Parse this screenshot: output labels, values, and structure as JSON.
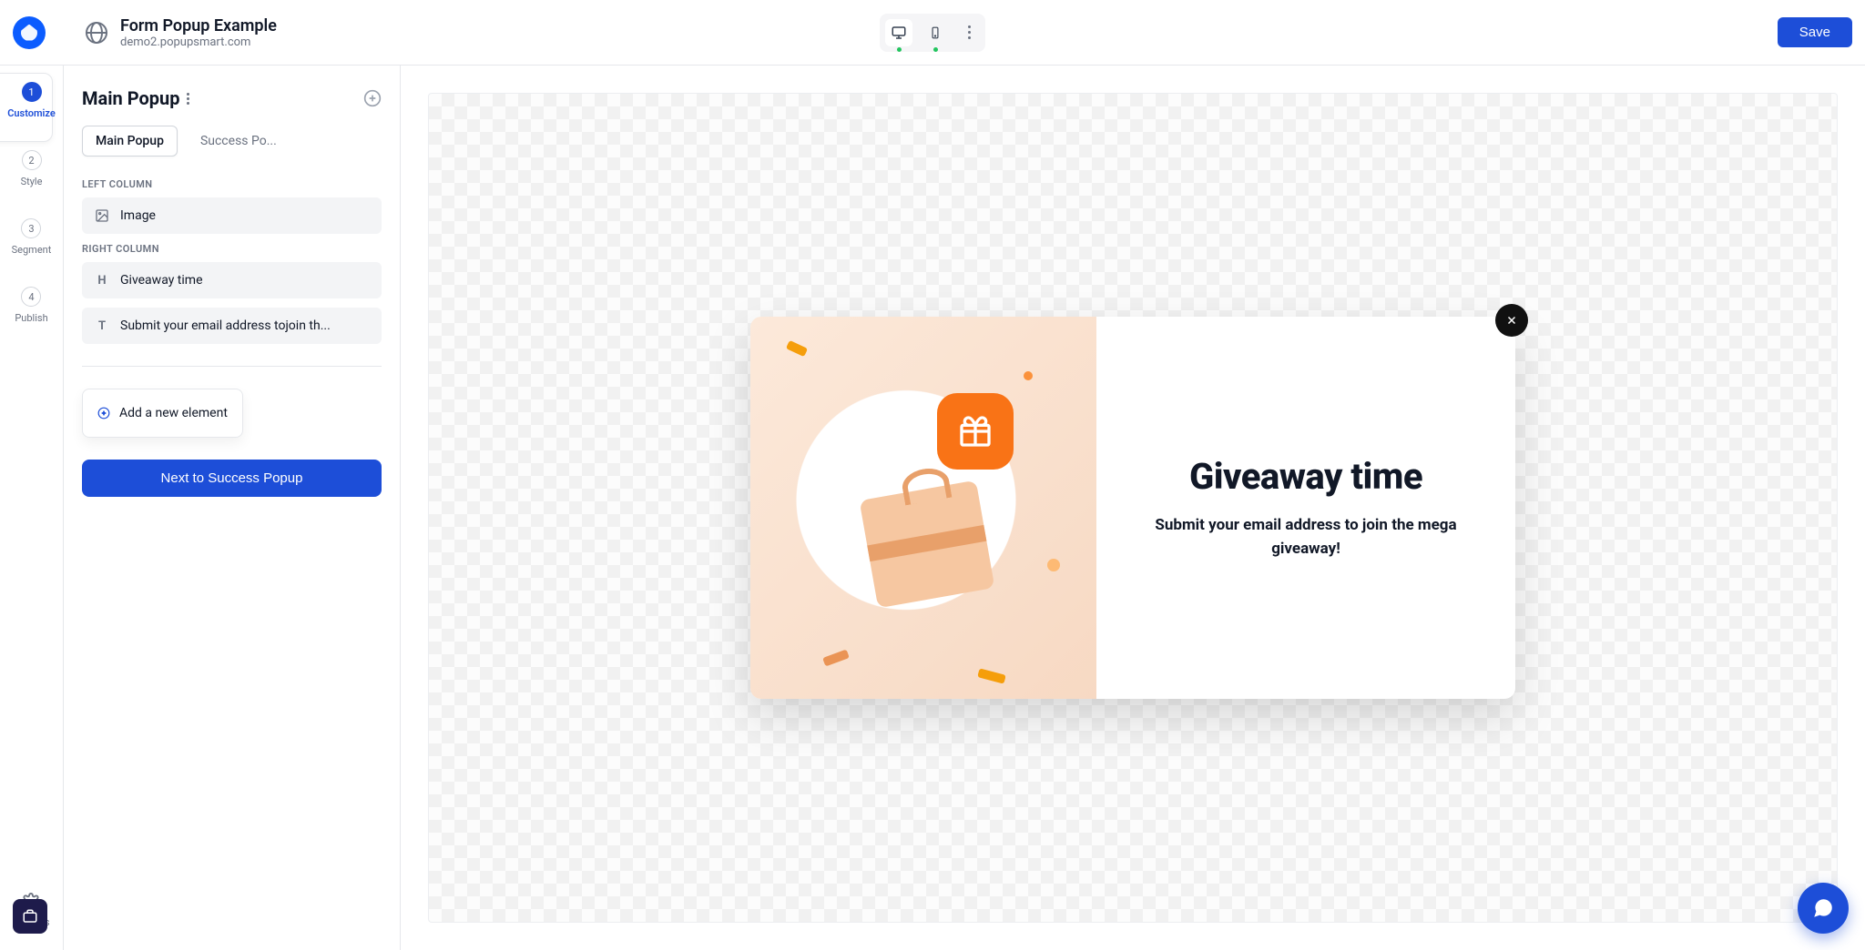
{
  "header": {
    "title": "Form Popup Example",
    "domain": "demo2.popupsmart.com",
    "save_label": "Save"
  },
  "rail": {
    "steps": [
      {
        "num": "1",
        "label": "Customize"
      },
      {
        "num": "2",
        "label": "Style"
      },
      {
        "num": "3",
        "label": "Segment"
      },
      {
        "num": "4",
        "label": "Publish"
      }
    ],
    "settings_label": "Settings"
  },
  "panel": {
    "title": "Main Popup",
    "tabs": [
      {
        "label": "Main Popup",
        "active": true
      },
      {
        "label": "Success Po...",
        "active": false
      }
    ],
    "left_column_label": "LEFT COLUMN",
    "left_elements": [
      {
        "icon": "image",
        "label": "Image"
      }
    ],
    "right_column_label": "RIGHT COLUMN",
    "right_elements": [
      {
        "icon": "H",
        "label": "Giveaway time"
      },
      {
        "icon": "T",
        "label": "Submit your email address tojoin th..."
      }
    ],
    "add_new_label": "Add a new element",
    "next_label": "Next to Success Popup"
  },
  "popup": {
    "headline": "Giveaway time",
    "subtext": "Submit your email address to join the mega giveaway!"
  }
}
